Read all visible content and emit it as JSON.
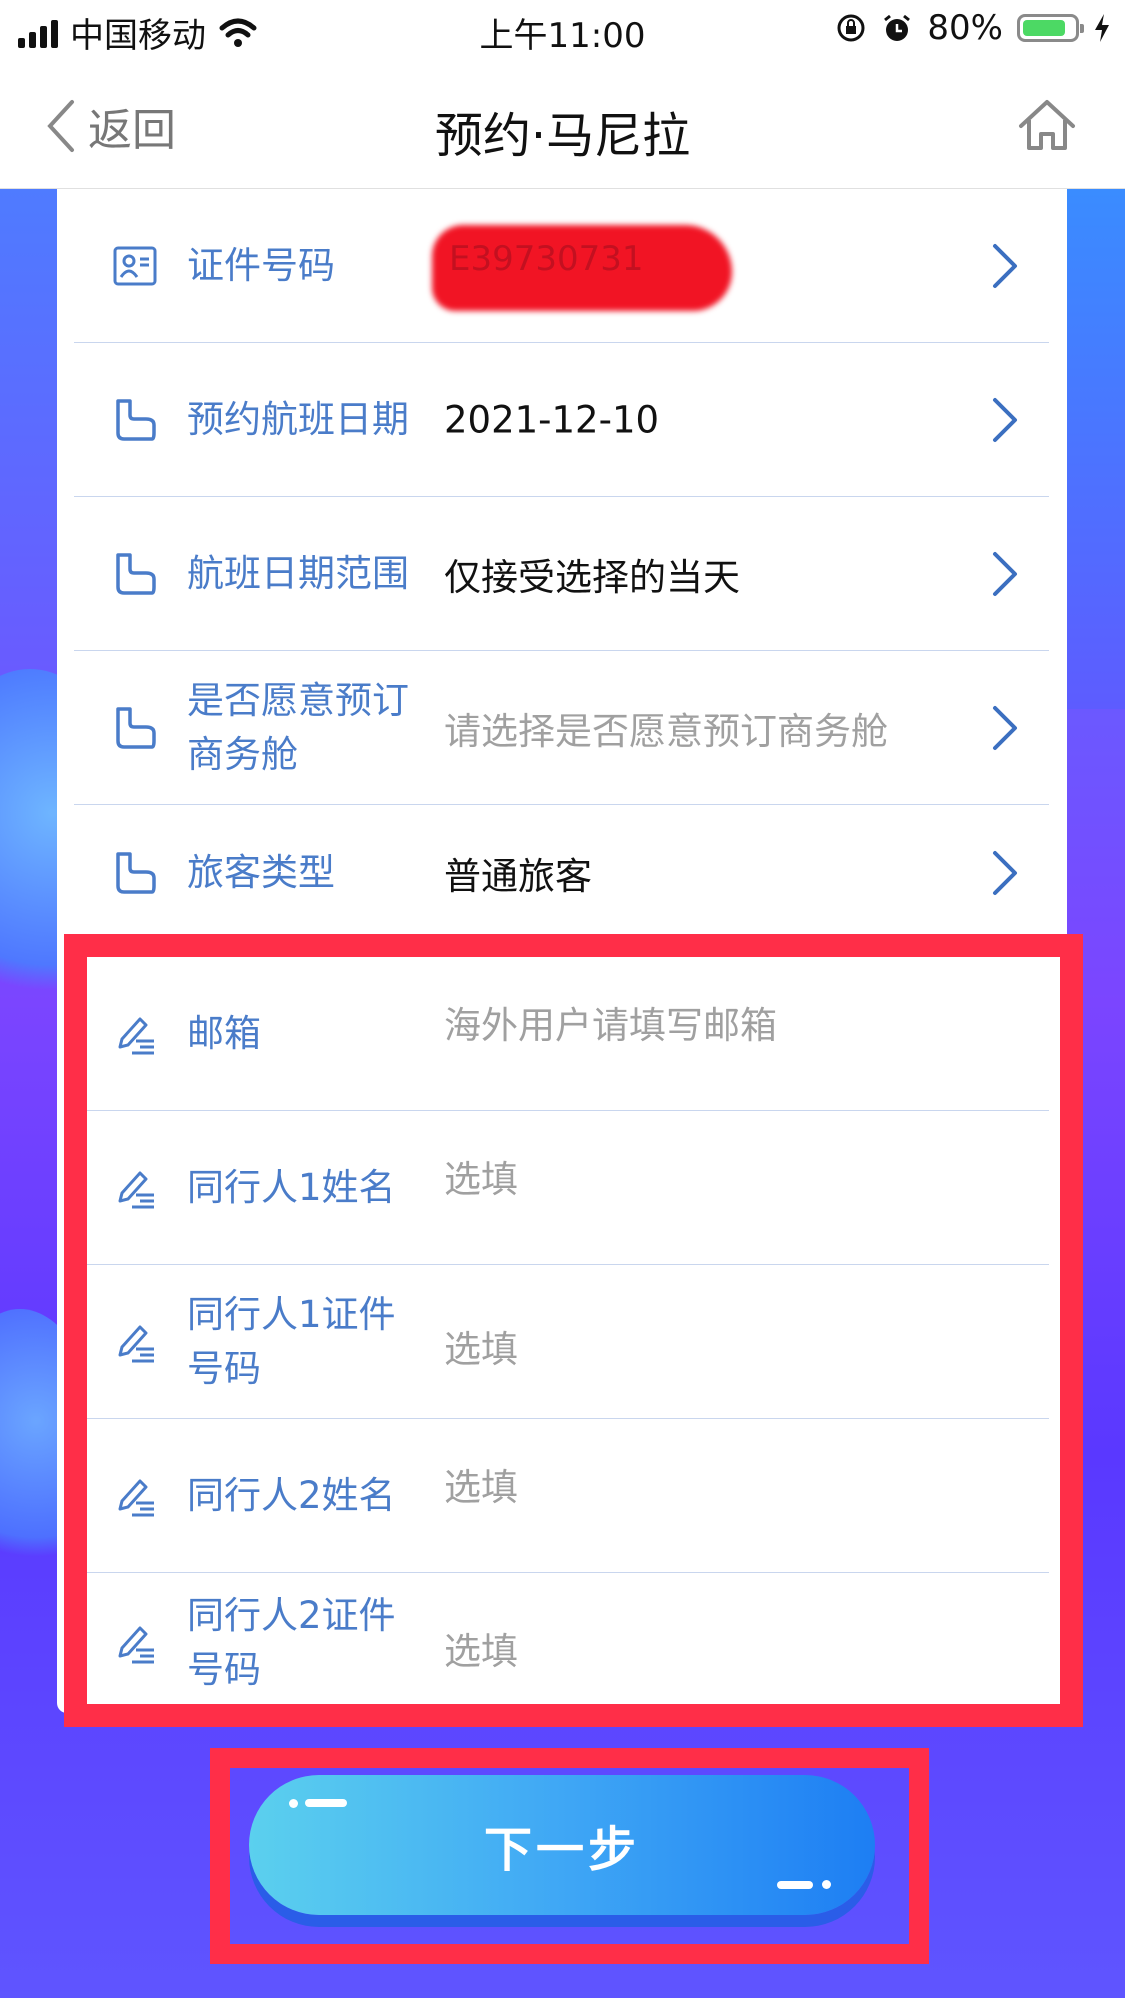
{
  "status_bar": {
    "carrier": "中国移动",
    "time": "上午11:00",
    "battery": "80%",
    "icons": [
      "signal-icon",
      "wifi-icon",
      "rotation-lock-icon",
      "alarm-icon",
      "battery-icon",
      "charging-icon"
    ]
  },
  "nav": {
    "back_label": "返回",
    "title": "预约·马尼拉",
    "icons": [
      "chevron-left-icon",
      "home-icon"
    ]
  },
  "form": {
    "rows": [
      {
        "label": "证件号码",
        "value": "E39730731",
        "icon": "id-card-icon",
        "redacted": true
      },
      {
        "label": "预约航班日期",
        "value": "2021-12-10",
        "icon": "form-item-icon"
      },
      {
        "label": "航班日期范围",
        "value": "仅接受选择的当天",
        "icon": "form-item-icon"
      },
      {
        "label": "是否愿意预订商务舱",
        "label_line1": "是否愿意预订",
        "label_line2": "商务舱",
        "placeholder": "请选择是否愿意预订商务舱",
        "icon": "form-item-icon"
      },
      {
        "label": "旅客类型",
        "value": "普通旅客",
        "icon": "form-item-icon"
      }
    ],
    "inputs": [
      {
        "label": "邮箱",
        "placeholder": "海外用户请填写邮箱",
        "icon": "edit-icon"
      },
      {
        "label": "同行人1姓名",
        "placeholder": "选填",
        "icon": "edit-icon"
      },
      {
        "label": "同行人1证件号码",
        "label_line1": "同行人1证件",
        "label_line2": "号码",
        "placeholder": "选填",
        "icon": "edit-icon"
      },
      {
        "label": "同行人2姓名",
        "placeholder": "选填",
        "icon": "edit-icon"
      },
      {
        "label": "同行人2证件号码",
        "label_line1": "同行人2证件",
        "label_line2": "号码",
        "placeholder": "选填",
        "icon": "edit-icon"
      }
    ]
  },
  "next_button": {
    "label": "下一步"
  },
  "colors": {
    "label_blue": "#4a7cc9",
    "highlight_red": "#ff2e48",
    "button_start": "#5bd0ee",
    "button_end": "#1d7ef3",
    "background_purple": "#7b45ff"
  }
}
